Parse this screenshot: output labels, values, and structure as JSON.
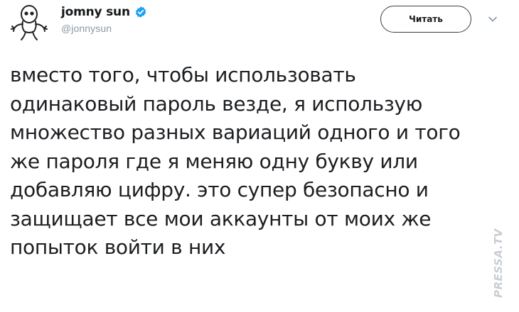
{
  "author": {
    "display_name": "jomny sun",
    "handle": "@jonnysun",
    "verified": true,
    "avatar_icon": "alien-doodle-avatar"
  },
  "actions": {
    "follow_label": "Читать",
    "more_icon": "chevron-down-icon"
  },
  "tweet": {
    "text": "вместо того, чтобы использовать\nодинаковый пароль везде, я использую\nмножество разных вариаций одного и того\nже пароля где я меняю одну букву или\nдобавляю цифру. это супер безопасно и\nзащищает все мои аккаунты от моих же\nпопыток войти в них"
  },
  "watermark": {
    "text": "PRESSA.TV"
  },
  "colors": {
    "verified_badge": "#1da1f2",
    "handle": "#8899a6",
    "text": "#1c1e21"
  }
}
